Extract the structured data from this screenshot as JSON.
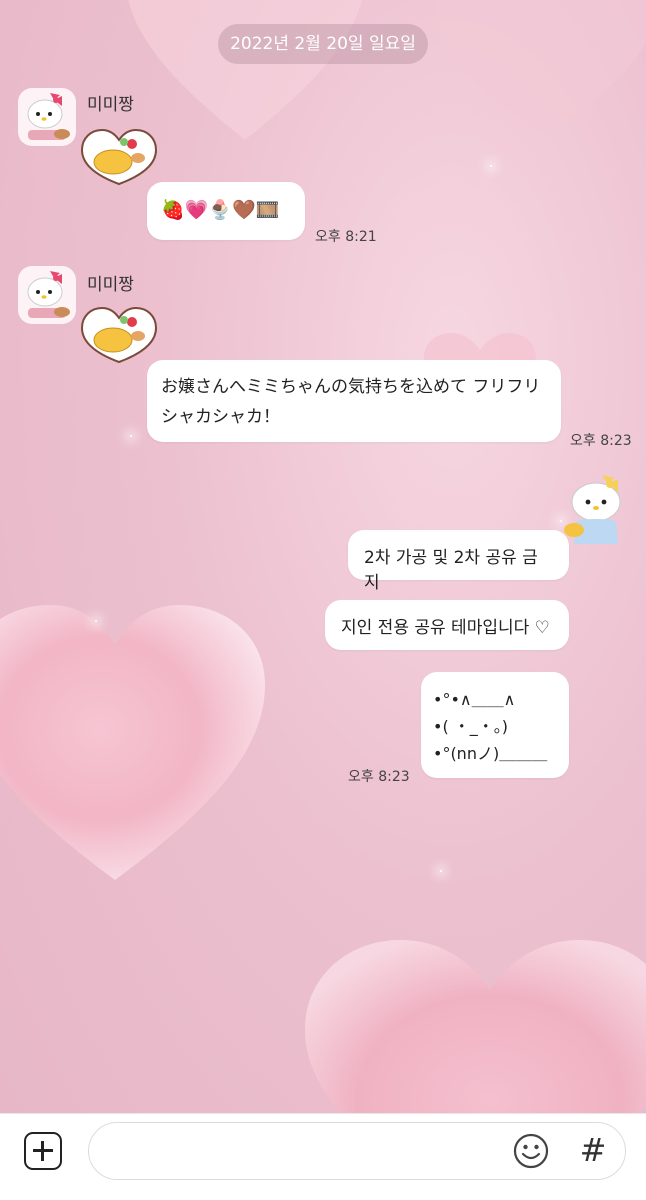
{
  "date_label": "2022년 2월 20일 일요일",
  "messages_left": [
    {
      "sender": "미미짱",
      "bubble_lines": [
        "🍓💗🍨🤎🎞️"
      ],
      "time": "오후 8:21"
    },
    {
      "sender": "미미짱",
      "bubble_lines": [
        "お嬢さんへミミちゃんの気持ちを込めて フリフリ",
        "シャカシャカ！"
      ],
      "time": "오후 8:23"
    }
  ],
  "messages_right": [
    {
      "text": "2차 가공 및 2차 공유 금지"
    },
    {
      "text": "지인 전용 공유 테마입니다 ♡"
    },
    {
      "lines": [
        "•°•∧＿＿∧",
        "•( ・_・。)",
        "•°(nnノ)＿＿＿"
      ]
    }
  ],
  "right_time": "오후 8:23",
  "input": {
    "placeholder": ""
  },
  "colors": {
    "background": "#ecc0cf",
    "bubble": "#ffffff"
  },
  "icons": [
    "plus-icon",
    "emoji-icon",
    "hashtag-icon"
  ]
}
